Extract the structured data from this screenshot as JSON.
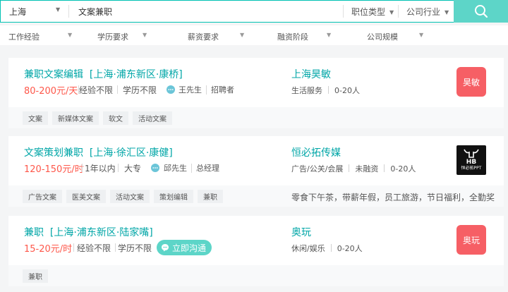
{
  "search": {
    "city": "上海",
    "keyword": "文案兼职",
    "position_type": "职位类型",
    "industry": "公司行业"
  },
  "filters": [
    "工作经验",
    "学历要求",
    "薪资要求",
    "融资阶段",
    "公司规模"
  ],
  "jobs": [
    {
      "title": "兼职文案编辑",
      "location": "[上海·浦东新区·康桥]",
      "salary": "80-200元/天",
      "experience": "经验不限",
      "education": "学历不限",
      "recruiter_name": "王先生",
      "recruiter_role": "招聘者",
      "company": "上海昊敏",
      "company_industry": "生活服务",
      "company_size": "0-20人",
      "logo_text": "昊敏",
      "tags": [
        "文案",
        "新媒体文案",
        "软文",
        "活动文案"
      ]
    },
    {
      "title": "文案策划兼职",
      "location": "[上海·徐汇区·康健]",
      "salary": "120-150元/时",
      "experience": "1年以内",
      "education": "大专",
      "recruiter_name": "邱先生",
      "recruiter_role": "总经理",
      "company": "恒必拓传媒",
      "company_industry": "广告/公关/会展",
      "company_funding": "未融资",
      "company_size": "0-20人",
      "logo_text": "HB",
      "logo_subtext": "恒必拓PPT",
      "tags": [
        "广告文案",
        "医美文案",
        "活动文案",
        "策划编辑",
        "兼职"
      ],
      "benefits": "零食下午茶，带薪年假，员工旅游，节日福利，全勤奖"
    },
    {
      "title": "兼职",
      "location": "[上海·浦东新区·陆家嘴]",
      "salary": "15-20元/时",
      "experience": "经验不限",
      "education": "学历不限",
      "chat_label": "立即沟通",
      "company": "奥玩",
      "company_industry": "休闲/娱乐",
      "company_size": "0-20人",
      "logo_text": "奥玩",
      "tags": [
        "兼职"
      ]
    }
  ],
  "colors": {
    "accent": "#00a6a7",
    "salary": "#fe574a",
    "search_button": "#5dd5c8",
    "logo_red": "#f65f65"
  }
}
